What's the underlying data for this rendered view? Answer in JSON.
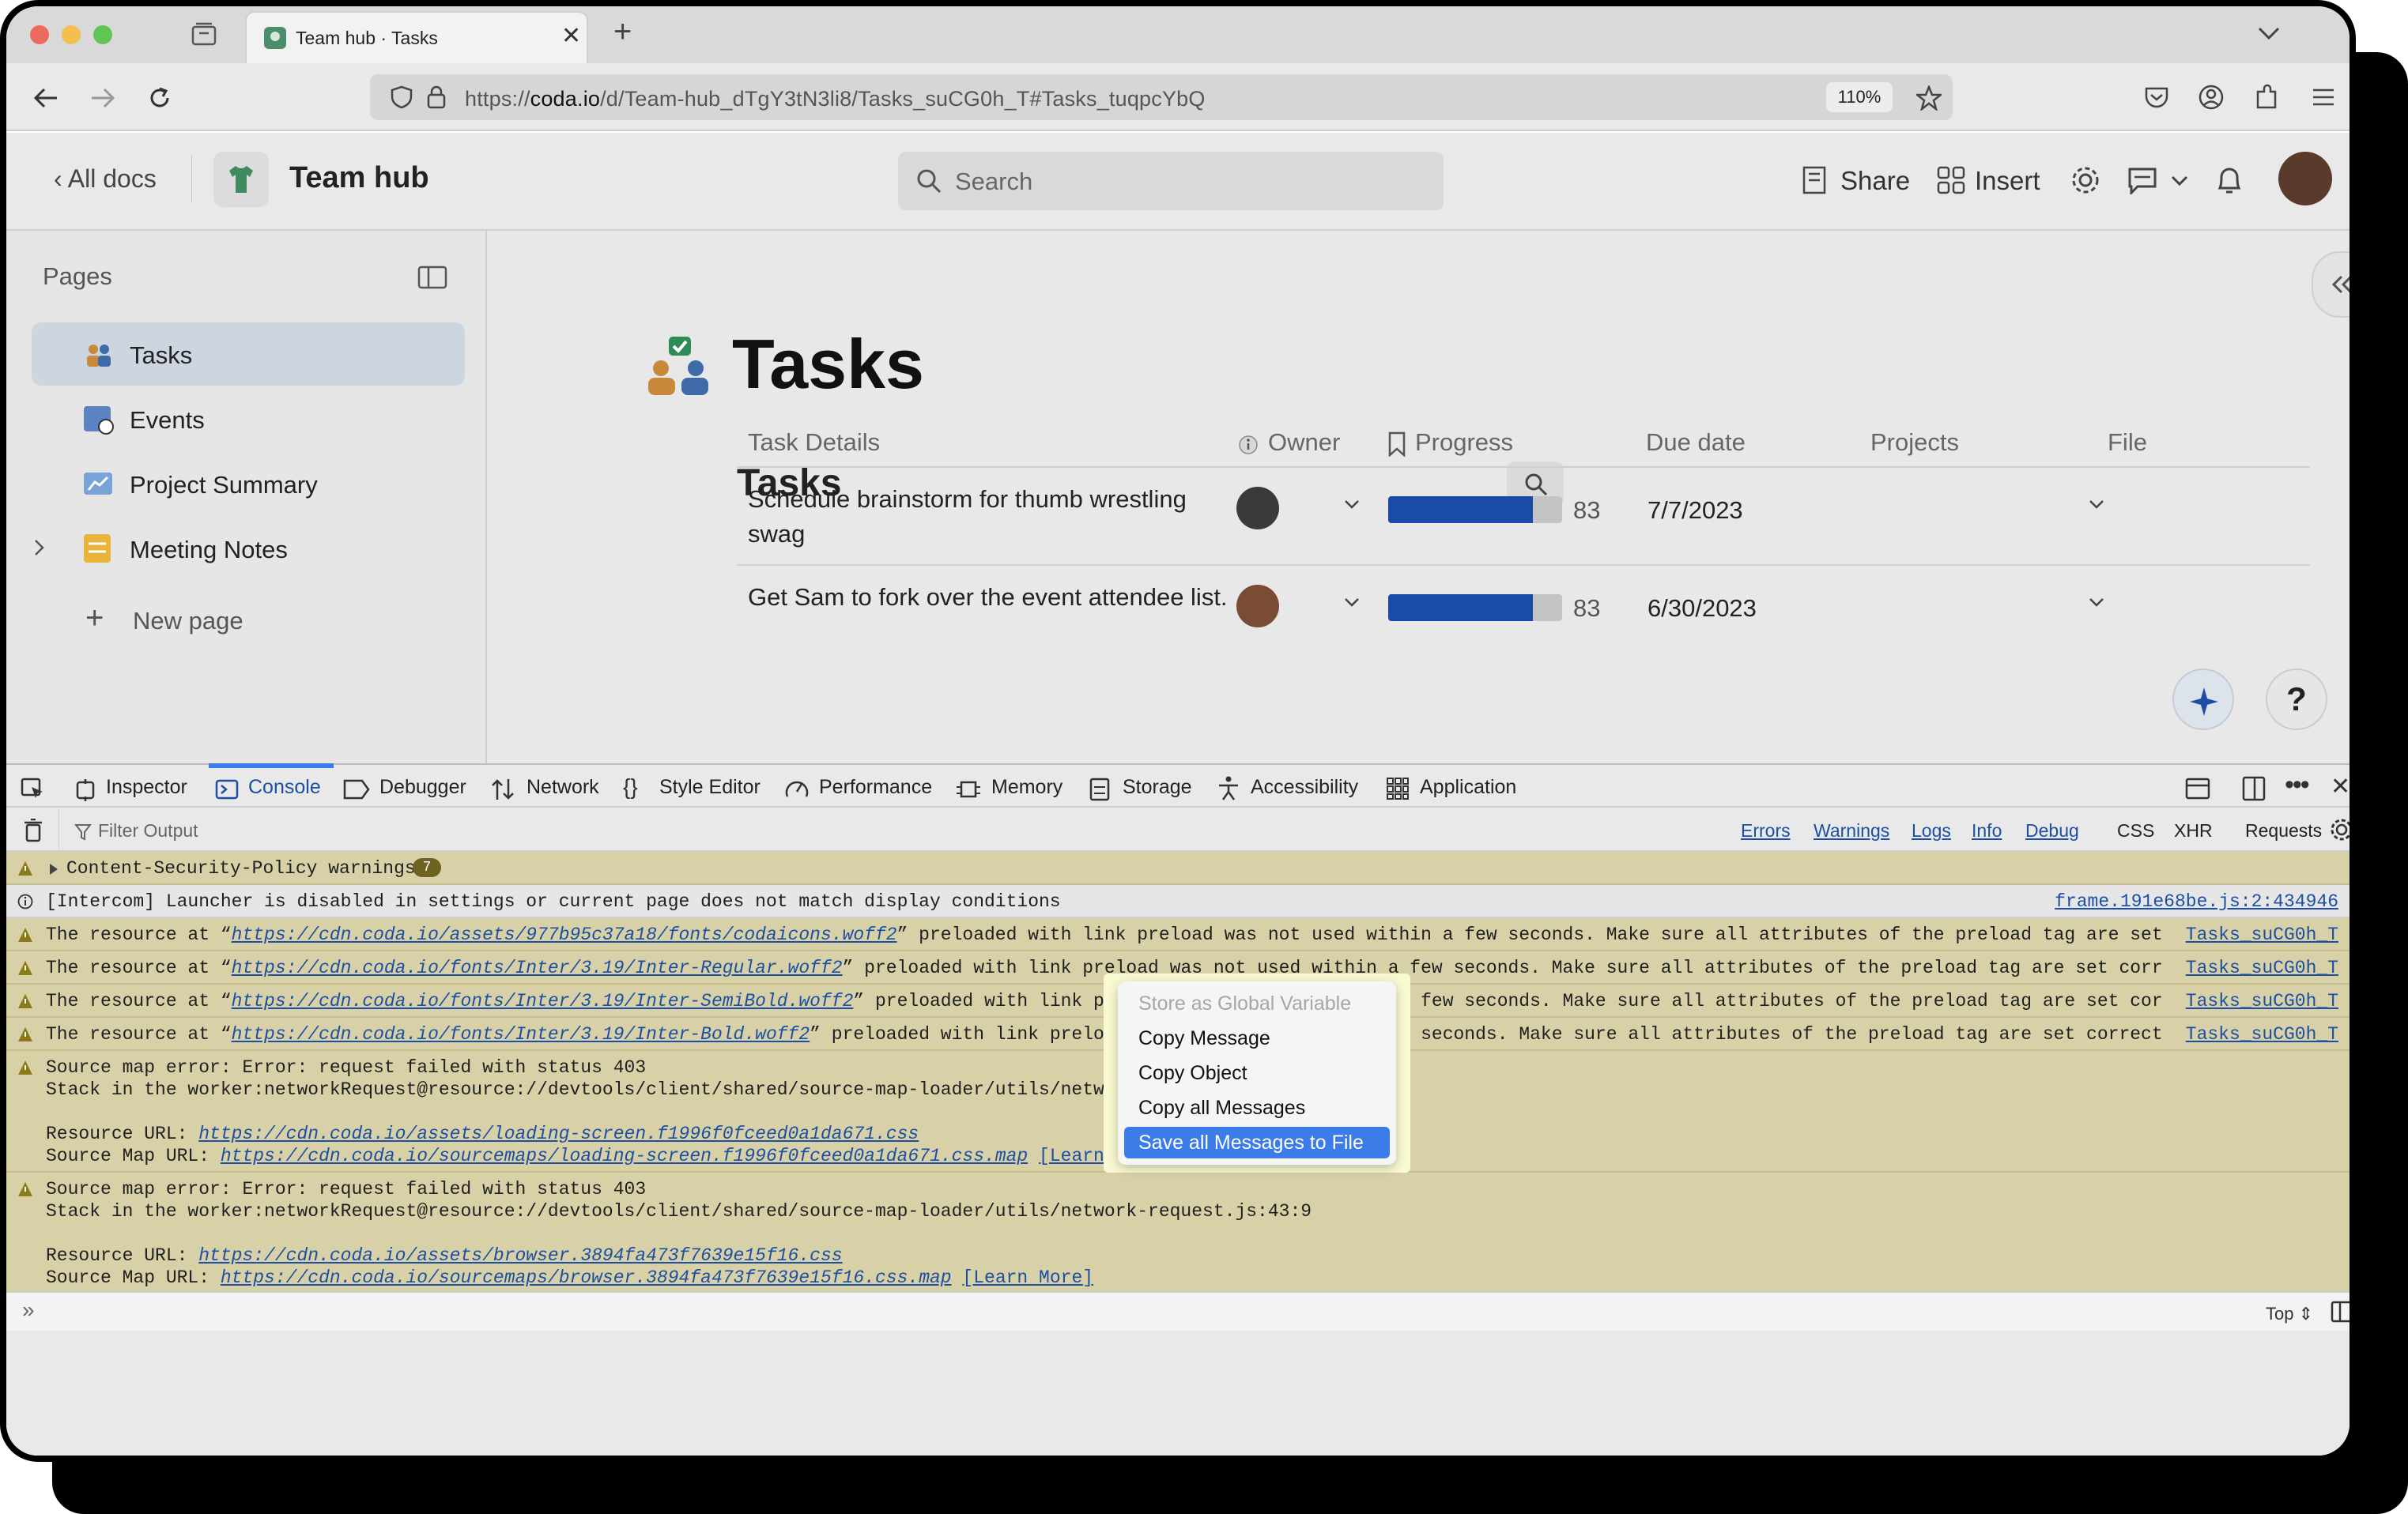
{
  "browser": {
    "tab_title": "Team hub · Tasks",
    "url_prefix": "https://",
    "url_host": "coda.io",
    "url_path": "/d/Team-hub_dTgY3tN3li8/Tasks_suCG0h_T#Tasks_tuqpcYbQ",
    "zoom": "110%"
  },
  "app": {
    "back_label": "All docs",
    "doc_title": "Team hub",
    "search_placeholder": "Search",
    "share_label": "Share",
    "insert_label": "Insert"
  },
  "sidebar": {
    "title": "Pages",
    "items": [
      {
        "label": "Tasks"
      },
      {
        "label": "Events"
      },
      {
        "label": "Project Summary"
      },
      {
        "label": "Meeting Notes"
      }
    ],
    "new_page": "New page"
  },
  "page": {
    "title": "Tasks",
    "table_title": "Tasks",
    "columns": [
      "Task Details",
      "Owner",
      "Progress",
      "Due date",
      "Projects",
      "File"
    ],
    "rows": [
      {
        "task": "Schedule brainstorm for thumb wrestling swag",
        "progress": 83,
        "progress_label": "83",
        "due": "7/7/2023"
      },
      {
        "task": "Get Sam to fork over the event attendee list.",
        "progress": 83,
        "progress_label": "83",
        "due": "6/30/2023"
      }
    ],
    "help_label": "?"
  },
  "devtools": {
    "tabs": [
      "Inspector",
      "Console",
      "Debugger",
      "Network",
      "Style Editor",
      "Performance",
      "Memory",
      "Storage",
      "Accessibility",
      "Application"
    ],
    "filter_placeholder": "Filter Output",
    "filters": [
      "Errors",
      "Warnings",
      "Logs",
      "Info",
      "Debug"
    ],
    "extra_filters": [
      "CSS",
      "XHR",
      "Requests"
    ],
    "csp_group": "Content-Security-Policy warnings",
    "csp_count": "7",
    "intercom": "[Intercom] Launcher is disabled in settings or current page does not match display conditions",
    "intercom_src": "frame.191e68be.js:2:434946",
    "preload_prefix": "The resource at “",
    "preload_suffix": "” preloaded with link preload was not used within a few seconds. Make sure all attributes of the preload tag are set correctly.",
    "preload_urls": [
      "https://cdn.coda.io/assets/977b95c37a18/fonts/codaicons.woff2",
      "https://cdn.coda.io/fonts/Inter/3.19/Inter-Regular.woff2",
      "https://cdn.coda.io/fonts/Inter/3.19/Inter-SemiBold.woff2",
      "https://cdn.coda.io/fonts/Inter/3.19/Inter-Bold.woff2"
    ],
    "preload_src": "Tasks_suCG0h_T",
    "sm_error": "Source map error: Error: request failed with status 403",
    "sm_stack": "Stack in the worker:networkRequest@resource://devtools/client/shared/source-map-loader/utils/network-request.js:43:9",
    "res_label": "Resource URL: ",
    "map_label": "Source Map URL: ",
    "sm1_res": "https://cdn.coda.io/assets/loading-screen.f1996f0fceed0a1da671.css",
    "sm1_map": "https://cdn.coda.io/sourcemaps/loading-screen.f1996f0fceed0a1da671.css.map",
    "sm2_res": "https://cdn.coda.io/assets/browser.3894fa473f7639e15f16.css",
    "sm2_map": "https://cdn.coda.io/sourcemaps/browser.3894fa473f7639e15f16.css.map",
    "learn_more": "[Learn More]",
    "context_top": "Top"
  },
  "context_menu": {
    "items": [
      "Store as Global Variable",
      "Copy Message",
      "Copy Object",
      "Copy all Messages",
      "Save all Messages to File"
    ]
  },
  "colors": {
    "accent": "#3c7ce8",
    "progress": "#1b4ba8",
    "warn_bg": "#d8d1a8"
  }
}
